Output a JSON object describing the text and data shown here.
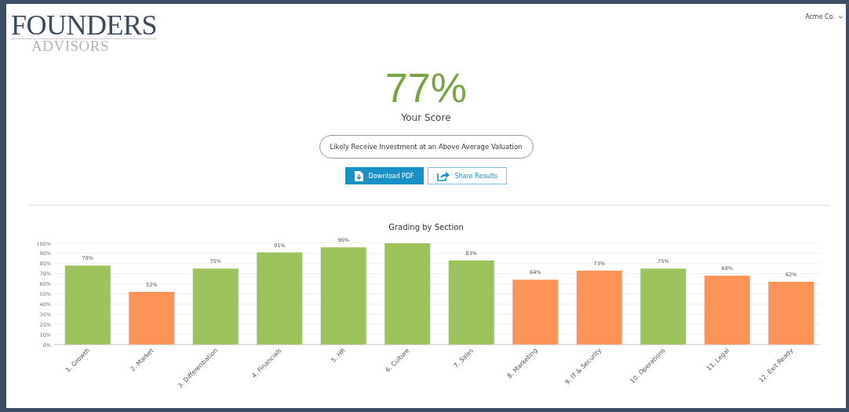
{
  "logo": {
    "line_1": "FOUNDERS",
    "line_2": "ADVISORS"
  },
  "account_menu": {
    "label": "Acme Co."
  },
  "score": {
    "value": "77%",
    "label": "Your Score"
  },
  "verdict": "Likely Receive Investment at an Above Average Valuation",
  "buttons": [
    {
      "kind": "primary",
      "label": "Download PDF"
    },
    {
      "kind": "secondary",
      "label": "Share Results"
    }
  ],
  "chart": {
    "chart_data": {
      "type": "bar",
      "title": "Grading by Section",
      "categories": [
        "1. Growth",
        "2. Market",
        "3. Differentiation",
        "4. Financials",
        "5. HR",
        "6. Culture",
        "7. Sales",
        "8. Marketing",
        "9. IT & Security",
        "10. Operations",
        "11. Legal",
        "12. Exit Ready"
      ],
      "values": [
        78,
        52,
        75,
        91,
        96,
        100,
        83,
        64,
        73,
        75,
        68,
        62
      ],
      "colors": [
        "#9dc25c",
        "#fd9457",
        "#9dc25c",
        "#9dc25c",
        "#9dc25c",
        "#9dc25c",
        "#9dc25c",
        "#fd9457",
        "#fd9457",
        "#9dc25c",
        "#fd9457",
        "#fd9457"
      ],
      "value_labels": [
        "78%",
        "52%",
        "75%",
        "91%",
        "96%",
        null,
        "83%",
        "64%",
        "73%",
        "75%",
        "68%",
        "62%"
      ],
      "ylim": [
        0,
        100
      ],
      "grid": true,
      "yticks": [
        {
          "value": 0,
          "label": "0%"
        },
        {
          "value": 10,
          "label": "10%"
        },
        {
          "value": 20,
          "label": "20%"
        },
        {
          "value": 30,
          "label": "30%"
        },
        {
          "value": 40,
          "label": "40%"
        },
        {
          "value": 50,
          "label": "50%"
        },
        {
          "value": 60,
          "label": "60%"
        },
        {
          "value": 70,
          "label": "70%"
        },
        {
          "value": 80,
          "label": "80%"
        },
        {
          "value": 90,
          "label": "90%"
        },
        {
          "value": 100,
          "label": "100%"
        }
      ]
    }
  }
}
